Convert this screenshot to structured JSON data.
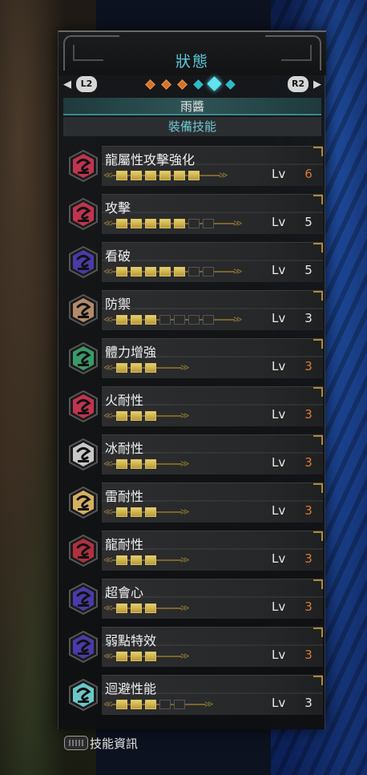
{
  "header": {
    "title": "狀態",
    "left_button": "L2",
    "right_button": "R2",
    "page_dots": [
      "orange",
      "orange",
      "orange",
      "cyan",
      "active",
      "cyan"
    ]
  },
  "character_name": "雨醬",
  "section_title": "裝備技能",
  "skills": [
    {
      "name": "龍屬性攻擊強化",
      "lv_label": "Lv",
      "level": "6",
      "filled": 6,
      "empty": 0,
      "max": true,
      "color": "#c0344e"
    },
    {
      "name": "攻擊",
      "lv_label": "Lv",
      "level": "5",
      "filled": 5,
      "empty": 2,
      "max": false,
      "color": "#c0344e"
    },
    {
      "name": "看破",
      "lv_label": "Lv",
      "level": "5",
      "filled": 5,
      "empty": 2,
      "max": false,
      "color": "#4a3aa8"
    },
    {
      "name": "防禦",
      "lv_label": "Lv",
      "level": "3",
      "filled": 3,
      "empty": 4,
      "max": false,
      "color": "#b48a6a"
    },
    {
      "name": "體力增強",
      "lv_label": "Lv",
      "level": "3",
      "filled": 3,
      "empty": 0,
      "max": true,
      "color": "#3a9a6a"
    },
    {
      "name": "火耐性",
      "lv_label": "Lv",
      "level": "3",
      "filled": 3,
      "empty": 0,
      "max": true,
      "color": "#c0344e"
    },
    {
      "name": "冰耐性",
      "lv_label": "Lv",
      "level": "3",
      "filled": 3,
      "empty": 0,
      "max": true,
      "color": "#c8c8c8"
    },
    {
      "name": "雷耐性",
      "lv_label": "Lv",
      "level": "3",
      "filled": 3,
      "empty": 0,
      "max": true,
      "color": "#d4b060"
    },
    {
      "name": "龍耐性",
      "lv_label": "Lv",
      "level": "3",
      "filled": 3,
      "empty": 0,
      "max": true,
      "color": "#b03040"
    },
    {
      "name": "超會心",
      "lv_label": "Lv",
      "level": "3",
      "filled": 3,
      "empty": 0,
      "max": true,
      "color": "#4a3aa8"
    },
    {
      "name": "弱點特效",
      "lv_label": "Lv",
      "level": "3",
      "filled": 3,
      "empty": 0,
      "max": true,
      "color": "#4a3aa8"
    },
    {
      "name": "迴避性能",
      "lv_label": "Lv",
      "level": "3",
      "filled": 3,
      "empty": 2,
      "max": false,
      "color": "#6ac8c8"
    }
  ],
  "footer": {
    "label": "技能資訊"
  },
  "colors": {
    "accent_cyan": "#5cc6da",
    "max_level": "#e07830",
    "pip_gold": "#d9c05e"
  }
}
